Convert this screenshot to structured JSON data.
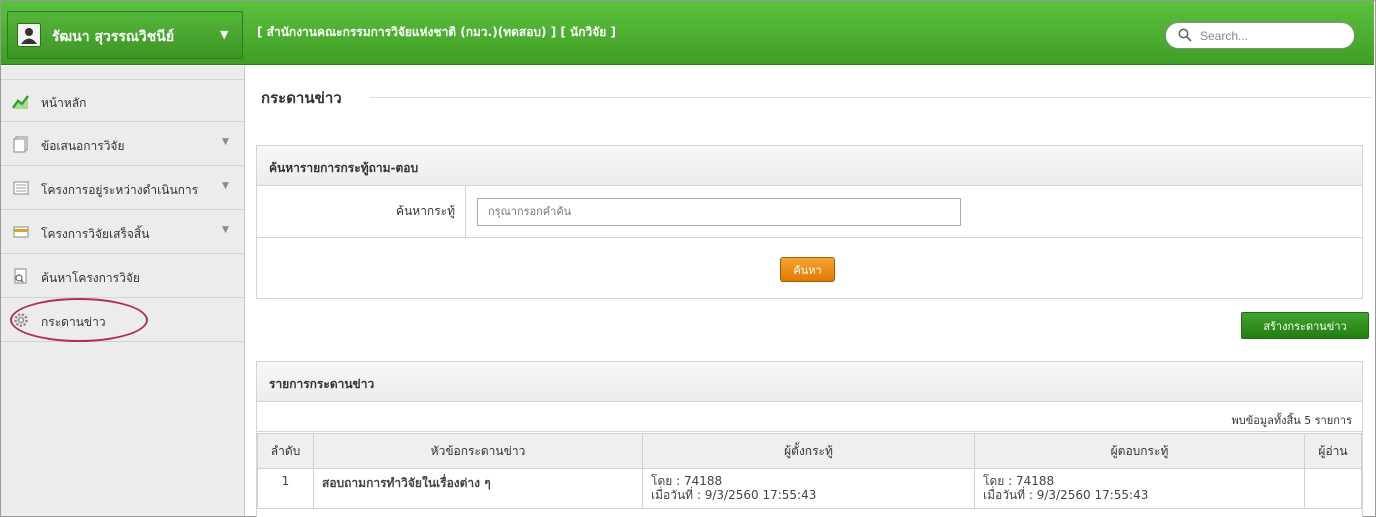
{
  "header": {
    "user_name": "รัฒนา สุวรรณวิชนีย์",
    "org_text": "[ สำนักงานคณะกรรมการวิจัยแห่งชาติ (กมว.)(ทดสอบ) ] [ นักวิจัย ]",
    "search_placeholder": "Search..."
  },
  "sidebar": {
    "items": [
      {
        "label": "หน้าหลัก",
        "icon": "chart-icon"
      },
      {
        "label": "ข้อเสนอการวิจัย",
        "icon": "document-icon",
        "has_submenu": true
      },
      {
        "label": "โครงการอยู่ระหว่างดำเนินการ",
        "icon": "list-icon",
        "has_submenu": true
      },
      {
        "label": "โครงการวิจัยเสร็จสิ้น",
        "icon": "card-icon",
        "has_submenu": true
      },
      {
        "label": "ค้นหาโครงการวิจัย",
        "icon": "search-doc-icon"
      },
      {
        "label": "กระดานข่าว",
        "icon": "gear-icon",
        "active": true
      }
    ]
  },
  "main": {
    "page_title": "กระดานข่าว",
    "search_panel": {
      "title": "ค้นหารายการกระทู้ถาม-ตอบ",
      "field_label": "ค้นหากระทู้",
      "field_placeholder": "กรุณากรอกคำค้น",
      "search_button": "ค้นหา"
    },
    "create_button": "สร้างกระดานข่าว",
    "list_panel": {
      "title": "รายการกระดานข่าว",
      "count_text": "พบข้อมูลทั้งสิ้น 5 รายการ",
      "columns": [
        "ลำดับ",
        "หัวข้อกระดานข่าว",
        "ผู้ตั้งกระทู้",
        "ผู้ตอบกระทู้",
        "ผู้อ่าน"
      ],
      "rows": [
        {
          "no": "1",
          "topic": "สอบถามการทำวิจัยในเรื่องต่าง ๆ",
          "poster_by": "โดย : 74188",
          "poster_date": "เมื่อวันที่ : 9/3/2560 17:55:43",
          "replier_by": "โดย : 74188",
          "replier_date": "เมื่อวันที่ : 9/3/2560 17:55:43",
          "readers": ""
        }
      ]
    }
  },
  "colors": {
    "header_green": "#4caf32",
    "accent_orange": "#e88a10",
    "create_green": "#2e8f1e",
    "topic_blue": "#1f3f8f",
    "highlight_ring": "#b0314a"
  }
}
